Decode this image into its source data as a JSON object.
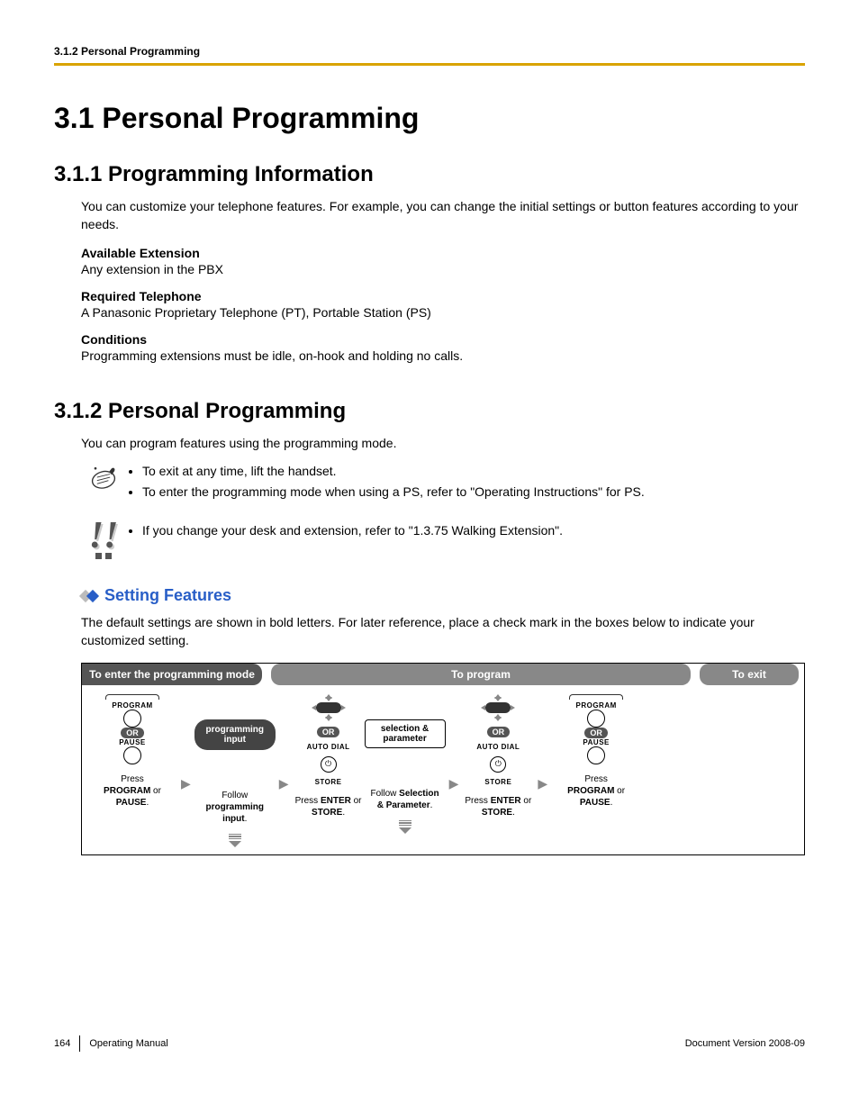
{
  "header": {
    "breadcrumb": "3.1.2 Personal Programming"
  },
  "h1": "3.1  Personal Programming",
  "s311": {
    "h2": "3.1.1  Programming Information",
    "intro": "You can customize your telephone features. For example, you can change the initial settings or button features according to your needs.",
    "avail_h": "Available Extension",
    "avail_t": "Any extension in the PBX",
    "req_h": "Required Telephone",
    "req_t": "A Panasonic Proprietary Telephone (PT), Portable Station (PS)",
    "cond_h": "Conditions",
    "cond_t": "Programming extensions must be idle, on-hook and holding no calls."
  },
  "s312": {
    "h2": "3.1.2  Personal Programming",
    "intro": "You can program features using the programming mode.",
    "note1_a": "To exit at any time, lift the handset.",
    "note1_b": "To enter the programming mode when using a PS, refer to \"Operating Instructions\" for PS.",
    "note2": "If you change your desk and extension, refer to \"1.3.75  Walking Extension\"."
  },
  "setting": {
    "head": "Setting Features",
    "intro": "The default settings are shown in bold letters. For later reference, place a check mark in the boxes below to indicate your customized setting."
  },
  "diagram": {
    "head1": "To enter the programming mode",
    "head2": "To program",
    "head3": "To exit",
    "program_lbl": "PROGRAM",
    "or": "OR",
    "pause_lbl": "PAUSE",
    "autodial_lbl": "AUTO DIAL",
    "store_lbl": "STORE",
    "prog_input": "programming input",
    "sel_param": "selection & parameter",
    "cap1a": "Press ",
    "cap1b": "PROGRAM",
    "cap1c": " or ",
    "cap1d": "PAUSE",
    "cap1e": ".",
    "cap2a": "Follow ",
    "cap2b": "programming input",
    "cap2c": ".",
    "cap3a": "Press ",
    "cap3b": "ENTER",
    "cap3c": " or ",
    "cap3d": "STORE",
    "cap3e": ".",
    "cap4a": "Follow ",
    "cap4b": "Selection & Parameter",
    "cap4c": ".",
    "cap5a": "Press ",
    "cap5b": "ENTER",
    "cap5c": " or ",
    "cap5d": "STORE",
    "cap5e": ".",
    "cap6a": "Press ",
    "cap6b": "PROGRAM",
    "cap6c": " or ",
    "cap6d": "PAUSE",
    "cap6e": "."
  },
  "footer": {
    "page": "164",
    "title": "Operating Manual",
    "version": "Document Version  2008-09"
  }
}
